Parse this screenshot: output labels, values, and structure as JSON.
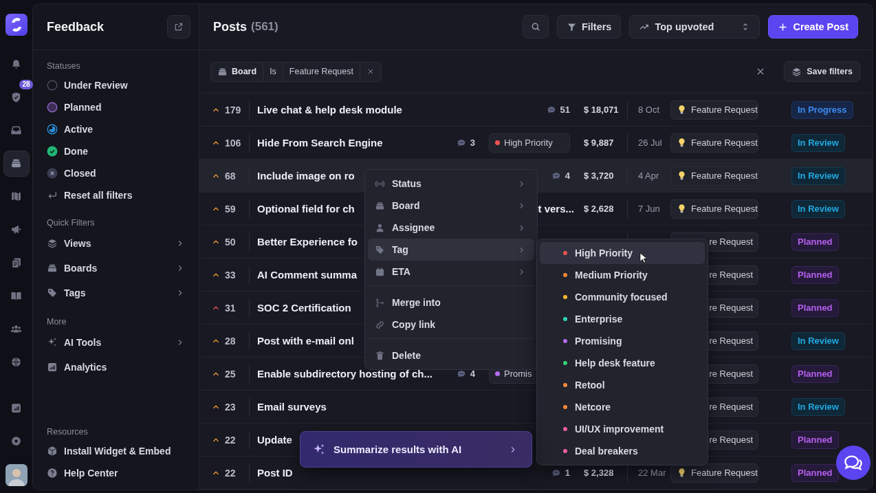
{
  "rail": {
    "items": [
      {
        "kind": "bell",
        "selected": false
      },
      {
        "kind": "shield",
        "selected": false,
        "badge": "28"
      },
      {
        "kind": "inbox",
        "selected": false
      },
      {
        "kind": "board",
        "selected": true
      },
      {
        "kind": "map",
        "selected": false
      },
      {
        "kind": "megaphone",
        "selected": false
      },
      {
        "kind": "docs",
        "selected": false
      },
      {
        "kind": "book",
        "selected": false
      },
      {
        "kind": "users",
        "selected": false
      },
      {
        "kind": "globe",
        "selected": false
      }
    ],
    "bottom_items": [
      {
        "kind": "chart",
        "selected": false
      },
      {
        "kind": "gear",
        "selected": false
      }
    ]
  },
  "sidebar": {
    "title": "Feedback",
    "sections": [
      {
        "heading": "Statuses",
        "items": [
          {
            "kind": "under-review",
            "label": "Under Review"
          },
          {
            "kind": "planned",
            "label": "Planned"
          },
          {
            "kind": "active",
            "label": "Active"
          },
          {
            "kind": "done",
            "label": "Done"
          },
          {
            "kind": "closed",
            "label": "Closed"
          },
          {
            "kind": "reset",
            "label": "Reset all filters"
          }
        ]
      },
      {
        "heading": "Quick Filters",
        "items": [
          {
            "kind": "views",
            "label": "Views",
            "has_submenu": true
          },
          {
            "kind": "boards",
            "label": "Boards",
            "has_submenu": true
          },
          {
            "kind": "tags",
            "label": "Tags",
            "has_submenu": true
          }
        ]
      },
      {
        "heading": "More",
        "items": [
          {
            "kind": "ai",
            "label": "AI Tools",
            "has_submenu": true
          },
          {
            "kind": "analytics",
            "label": "Analytics",
            "has_submenu": false
          }
        ]
      },
      {
        "heading": "Resources",
        "items": [
          {
            "kind": "widget",
            "label": "Install Widget & Embed",
            "has_submenu": false
          },
          {
            "kind": "help",
            "label": "Help Center",
            "has_submenu": false
          }
        ]
      }
    ]
  },
  "header": {
    "title": "Posts",
    "count": "(561)",
    "filters_label": "Filters",
    "sort_label": "Top upvoted",
    "create_label": "Create Post"
  },
  "filter_bar": {
    "chip": {
      "field": "Board",
      "operator": "Is",
      "value": "Feature Request"
    },
    "save_label": "Save filters"
  },
  "posts": [
    {
      "vote": {
        "count": "179",
        "color": "#e0912f"
      },
      "title": "Live chat & help desk module",
      "comments": "51",
      "amount": "$ 18,071",
      "date": "8 Oct",
      "board": {
        "label": "Feature Request",
        "kind": "full"
      },
      "status": {
        "label": "In Progress",
        "kind": "in-progress"
      },
      "hovered": false
    },
    {
      "vote": {
        "count": "106",
        "color": "#e0912f"
      },
      "title": "Hide From Search Engine",
      "comments": "3",
      "tag": {
        "label": "High Priority",
        "color": "#ef5350"
      },
      "amount": "$ 9,887",
      "date": "26 Jul",
      "board": {
        "label": "Feature Request",
        "kind": "full"
      },
      "status": {
        "label": "In Review",
        "kind": "in-review"
      },
      "hovered": false
    },
    {
      "vote": {
        "count": "68",
        "color": "#e0912f"
      },
      "title": "Include image on ro",
      "comments": "4",
      "amount": "$ 3,720",
      "date": "4 Apr",
      "board": {
        "label": "Feature Request",
        "kind": "full"
      },
      "status": {
        "label": "In Review",
        "kind": "in-review"
      },
      "hovered": true
    },
    {
      "vote": {
        "count": "59",
        "color": "#e0912f"
      },
      "title": "Optional field for ch",
      "title_tail": "t vers...",
      "amount": "$ 2,628",
      "date": "7 Jun",
      "board": {
        "label": "Feature Request",
        "kind": "full"
      },
      "status": {
        "label": "In Review",
        "kind": "in-review"
      },
      "hovered": false
    },
    {
      "vote": {
        "count": "50",
        "color": "#e0912f"
      },
      "title": "Better Experience fo",
      "board": {
        "label": "re Request",
        "kind": "cut"
      },
      "status": {
        "label": "Planned",
        "kind": "planned"
      },
      "hovered": false
    },
    {
      "vote": {
        "count": "33",
        "color": "#e0912f"
      },
      "title": "AI Comment summa",
      "board": {
        "label": "re Request",
        "kind": "cut"
      },
      "status": {
        "label": "Planned",
        "kind": "planned"
      },
      "hovered": false
    },
    {
      "vote": {
        "count": "31",
        "color": "#e0475a"
      },
      "title": "SOC 2 Certification",
      "board": {
        "label": "re Request",
        "kind": "cut"
      },
      "status": {
        "label": "Planned",
        "kind": "planned"
      },
      "hovered": false
    },
    {
      "vote": {
        "count": "28",
        "color": "#e0912f"
      },
      "title": "Post with e-mail onl",
      "board": {
        "label": "re Request",
        "kind": "cut"
      },
      "status": {
        "label": "In Review",
        "kind": "in-review"
      },
      "hovered": false
    },
    {
      "vote": {
        "count": "25",
        "color": "#e0912f"
      },
      "title": "Enable subdirectory hosting of ch...",
      "comments": "4",
      "tag": {
        "label": "Promis",
        "color": "#b36cf0"
      },
      "board": {
        "label": "re Request",
        "kind": "cut"
      },
      "status": {
        "label": "Planned",
        "kind": "planned"
      },
      "hovered": false
    },
    {
      "vote": {
        "count": "23",
        "color": "#e0912f"
      },
      "title": "Email surveys",
      "board": {
        "label": "re Request",
        "kind": "cut"
      },
      "status": {
        "label": "In Review",
        "kind": "in-review"
      },
      "hovered": false
    },
    {
      "vote": {
        "count": "22",
        "color": "#e0912f"
      },
      "title": "Update",
      "board": {
        "label": "re Request",
        "kind": "cut"
      },
      "status": {
        "label": "Planned",
        "kind": "planned"
      },
      "hovered": false
    },
    {
      "vote": {
        "count": "22",
        "color": "#e0912f"
      },
      "title": "Post ID",
      "comments": "1",
      "amount": "$ 2,328",
      "date": "22 Mar",
      "board": {
        "label": "Feature Request",
        "kind": "full"
      },
      "status": {
        "label": "Planned",
        "kind": "planned"
      },
      "hovered": false
    }
  ],
  "context_menu": {
    "items": [
      {
        "kind": "status",
        "label": "Status",
        "has_submenu": true,
        "selected": false,
        "divider_before": false
      },
      {
        "kind": "board",
        "label": "Board",
        "has_submenu": true,
        "selected": false,
        "divider_before": false
      },
      {
        "kind": "assignee",
        "label": "Assignee",
        "has_submenu": true,
        "selected": false,
        "divider_before": false
      },
      {
        "kind": "tag",
        "label": "Tag",
        "has_submenu": true,
        "selected": true,
        "divider_before": false
      },
      {
        "kind": "eta",
        "label": "ETA",
        "has_submenu": true,
        "selected": false,
        "divider_before": false
      },
      {
        "kind": "merge",
        "label": "Merge into",
        "has_submenu": false,
        "selected": false,
        "divider_before": true
      },
      {
        "kind": "link",
        "label": "Copy link",
        "has_submenu": false,
        "selected": false,
        "divider_before": false
      },
      {
        "kind": "delete",
        "label": "Delete",
        "has_submenu": false,
        "selected": false,
        "divider_before": true
      }
    ]
  },
  "tag_menu": {
    "items": [
      {
        "label": "High Priority",
        "color": "#ef5350",
        "selected": true
      },
      {
        "label": "Medium Priority",
        "color": "#f5883a",
        "selected": false
      },
      {
        "label": "Community focused",
        "color": "#f5b82a",
        "selected": false
      },
      {
        "label": "Enterprise",
        "color": "#2dd4b5",
        "selected": false
      },
      {
        "label": "Promising",
        "color": "#b36cf0",
        "selected": false
      },
      {
        "label": "Help desk feature",
        "color": "#34d17a",
        "selected": false
      },
      {
        "label": "Retool",
        "color": "#f5883a",
        "selected": false
      },
      {
        "label": "Netcore",
        "color": "#f5883a",
        "selected": false
      },
      {
        "label": "UI/UX improvement",
        "color": "#f0609e",
        "selected": false
      },
      {
        "label": "Deal breakers",
        "color": "#f0609e",
        "selected": false
      }
    ]
  },
  "ai_bar": {
    "label": "Summarize results with AI"
  }
}
